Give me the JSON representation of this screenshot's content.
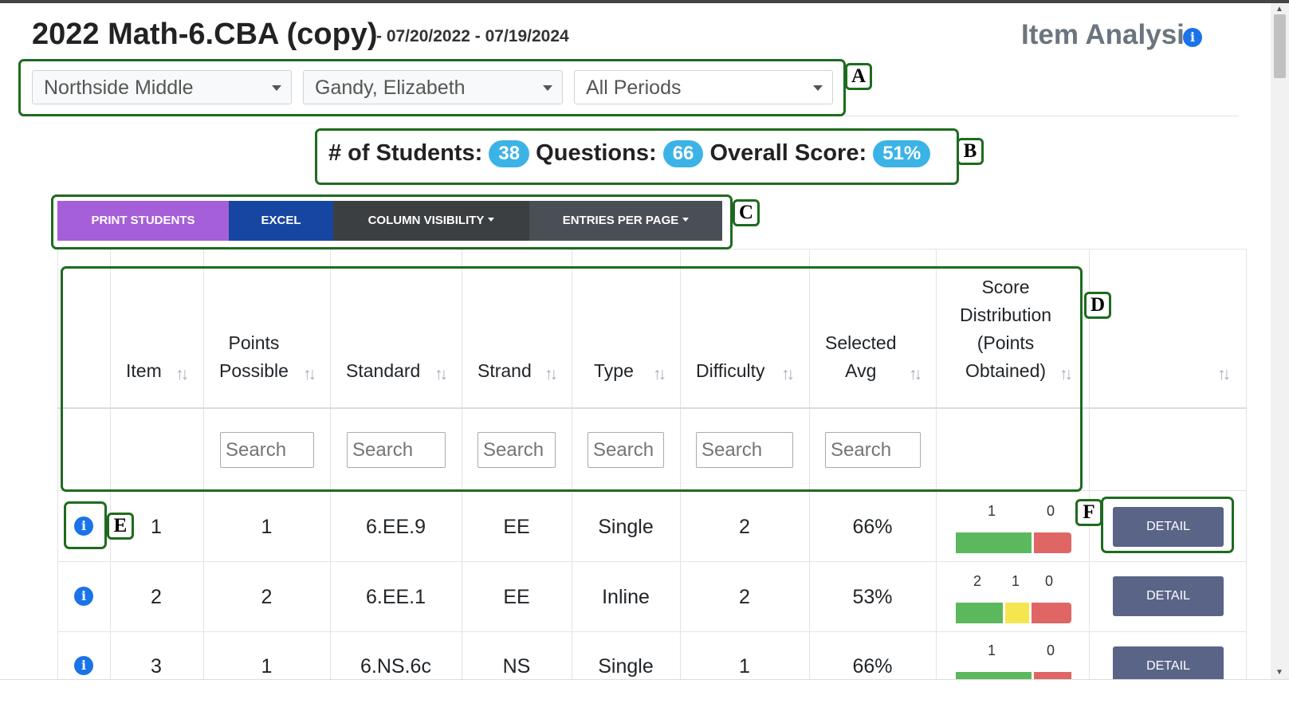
{
  "header": {
    "title": "2022 Math-6.CBA (copy)",
    "dates": "- 07/20/2022 - 07/19/2024",
    "page_title": "Item Analysis"
  },
  "filters": {
    "school": "Northside Middle",
    "teacher": "Gandy, Elizabeth",
    "period": "All Periods"
  },
  "stats": {
    "students_label": "# of Students:",
    "students": "38",
    "questions_label": "Questions:",
    "questions": "66",
    "score_label": "Overall Score:",
    "score": "51%"
  },
  "toolbar": {
    "print": "PRINT STUDENTS",
    "excel": "EXCEL",
    "column_visibility": "COLUMN VISIBILITY",
    "entries_per_page": "ENTRIES PER PAGE"
  },
  "table": {
    "columns": {
      "item": "Item",
      "points_1": "Points",
      "points_2": "Possible",
      "standard": "Standard",
      "strand": "Strand",
      "type": "Type",
      "difficulty": "Difficulty",
      "avg_1": "Selected",
      "avg_2": "Avg",
      "dist_1": "Score",
      "dist_2": "Distribution",
      "dist_3": "(Points",
      "dist_4": "Obtained)"
    },
    "search_placeholder": "Search",
    "detail_label": "DETAIL",
    "rows": [
      {
        "item": "1",
        "points": "1",
        "standard": "6.EE.9",
        "strand": "EE",
        "type": "Single",
        "difficulty": "2",
        "avg": "66%",
        "dist_labels": [
          "1",
          "0"
        ]
      },
      {
        "item": "2",
        "points": "2",
        "standard": "6.EE.1",
        "strand": "EE",
        "type": "Inline",
        "difficulty": "2",
        "avg": "53%",
        "dist_labels": [
          "2",
          "1",
          "0"
        ]
      },
      {
        "item": "3",
        "points": "1",
        "standard": "6.NS.6c",
        "strand": "NS",
        "type": "Single",
        "difficulty": "1",
        "avg": "66%",
        "dist_labels": [
          "1",
          "0"
        ]
      }
    ]
  },
  "annotations": [
    "A",
    "B",
    "C",
    "D",
    "E",
    "F"
  ],
  "colors": {
    "print": "#a55fd8",
    "excel": "#1746a2",
    "col_vis": "#3c3f42",
    "entries": "#4a4f55",
    "badge": "#3cb3e6",
    "annot": "#1e6b1e",
    "bar_green": "#5cb85c",
    "bar_yellow": "#f5e64f",
    "bar_red": "#e06666",
    "detail": "#5a6487"
  },
  "icons": [
    "info-icon",
    "caret-down-icon",
    "sort-icon"
  ]
}
